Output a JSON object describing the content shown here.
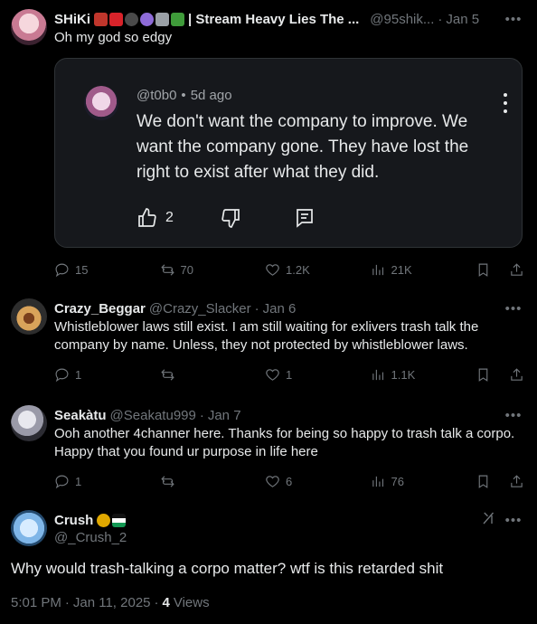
{
  "posts": [
    {
      "name": "SHiKi",
      "emoji_suffix": "| Stream Heavy Lies The ...",
      "handle": "@95shik...",
      "dot": "·",
      "date": "Jan 5",
      "text": "Oh my god so edgy",
      "actions": {
        "replies": "15",
        "reposts": "70",
        "likes": "1.2K",
        "views": "21K"
      },
      "embed": {
        "handle": "@t0b0",
        "dot": "•",
        "age": "5d ago",
        "text": "We don't want the company to improve. We want the company gone. They have lost the right to exist after what they did.",
        "likes": "2"
      }
    },
    {
      "name": "Crazy_Beggar",
      "handle": "@Crazy_Slacker",
      "dot": "·",
      "date": "Jan 6",
      "text": "Whistleblower laws still exist. I am still waiting for exlivers trash talk the company by name. Unless, they not protected by whistleblower laws.",
      "actions": {
        "replies": "1",
        "reposts": "",
        "likes": "1",
        "views": "1.1K"
      }
    },
    {
      "name": "Seakàtu",
      "handle": "@Seakatu999",
      "dot": "·",
      "date": "Jan 7",
      "text": "Ooh another 4channer here. Thanks for being so happy to trash talk a corpo. Happy that you found ur purpose in life here",
      "actions": {
        "replies": "1",
        "reposts": "",
        "likes": "6",
        "views": "76"
      }
    }
  ],
  "main_post": {
    "name": "Crush",
    "handle": "@_Crush_2",
    "text": "Why would trash-talking a corpo matter? wtf is this retarded shit",
    "time": "5:01 PM",
    "dot": "·",
    "date": "Jan 11, 2025",
    "dot2": "·",
    "views_count": "4",
    "views_label": "Views"
  },
  "icons": [
    "reply-icon",
    "repost-icon",
    "like-icon",
    "views-icon",
    "bookmark-icon",
    "share-icon",
    "more-icon",
    "thumbs-up-icon",
    "thumbs-down-icon",
    "comment-icon",
    "grok-icon"
  ],
  "colors": {
    "background": "#000000",
    "text": "#e7e9ea",
    "muted": "#71767b",
    "card": "#16181c",
    "border": "#2f3336"
  }
}
